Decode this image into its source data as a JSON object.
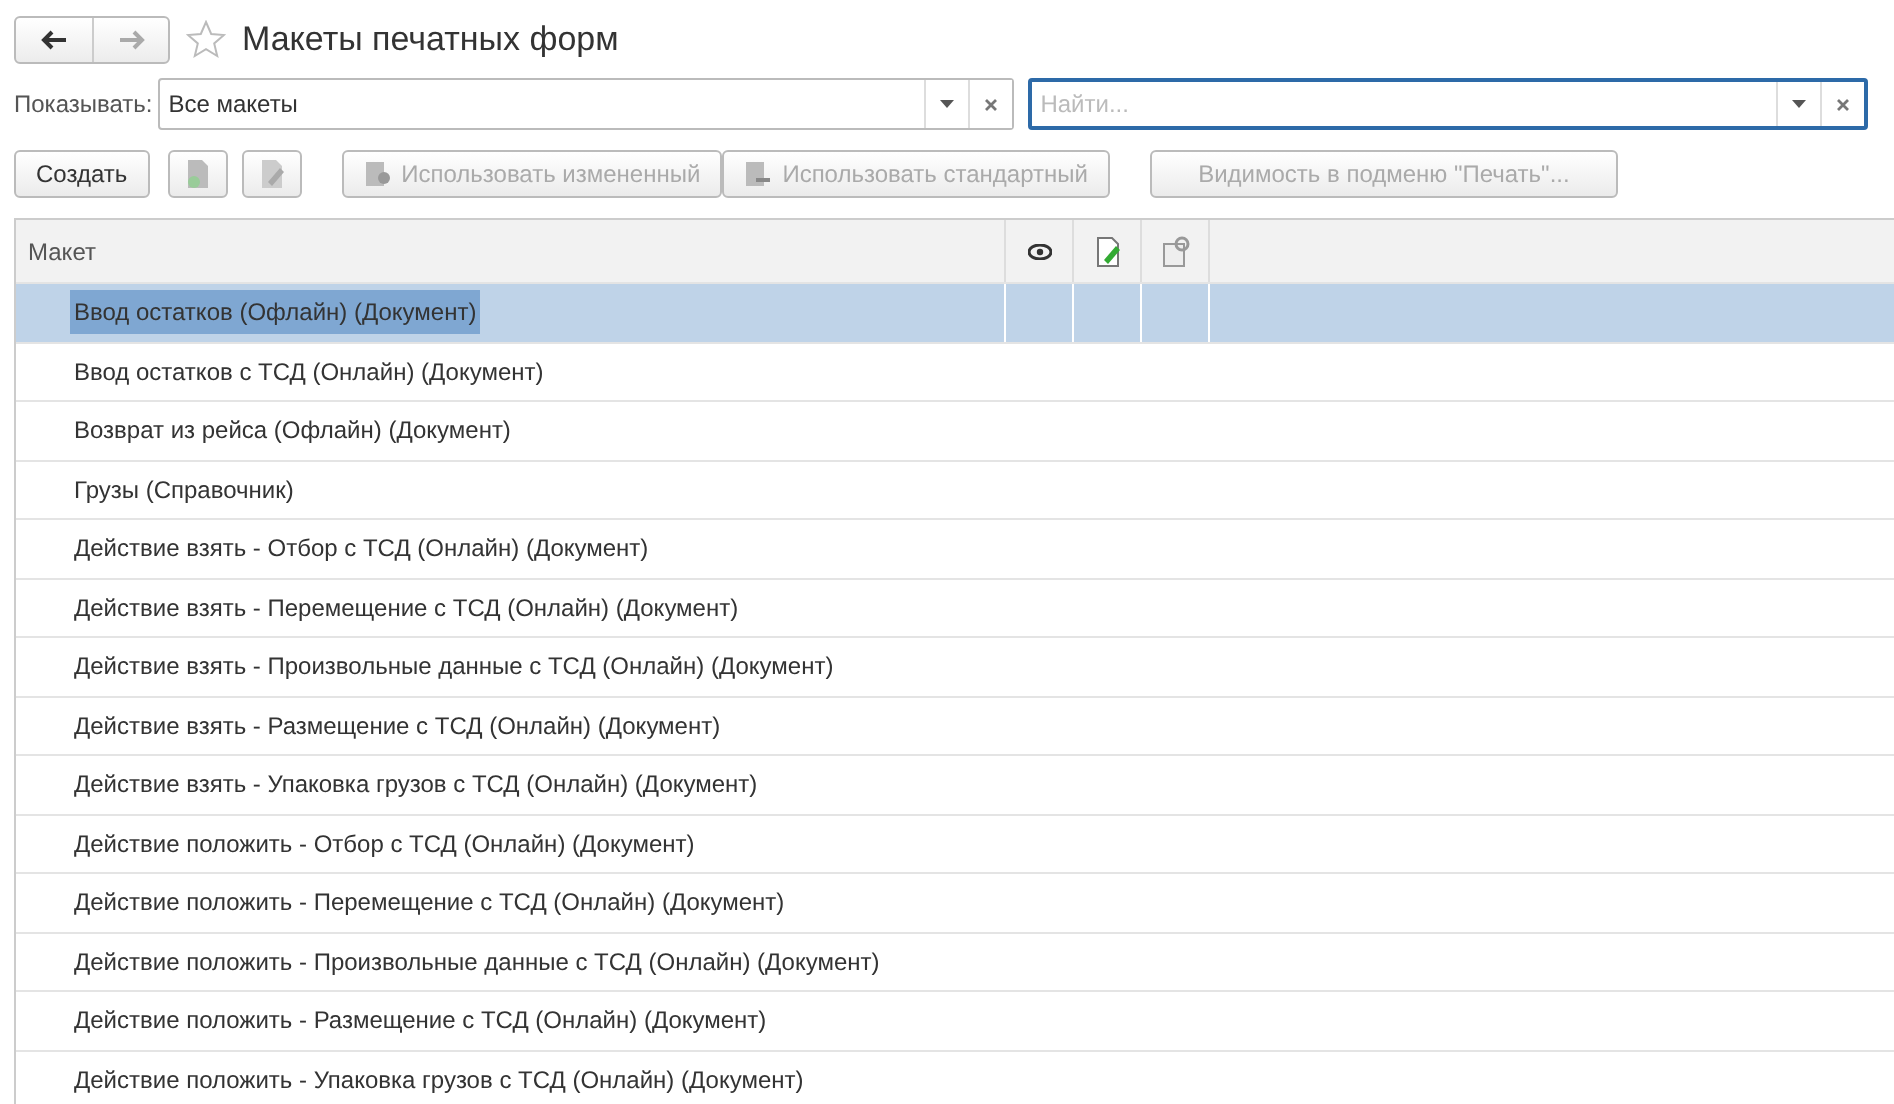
{
  "window": {
    "title": "Макеты печатных форм",
    "favorite": false
  },
  "filter": {
    "label": "Показывать:",
    "value": "Все макеты"
  },
  "search": {
    "placeholder": "Найти..."
  },
  "toolbar": {
    "create": "Создать",
    "use_changed": {
      "label": "Использовать измененный",
      "disabled": true
    },
    "use_standard": {
      "label": "Использовать стандартный",
      "disabled": true
    },
    "visibility": {
      "label": "Видимость в подменю \"Печать\"...",
      "disabled": true
    }
  },
  "table": {
    "columns": [
      "Макет"
    ],
    "rows": [
      {
        "name": "Ввод остатков (Офлайн) (Документ)",
        "selected": true
      },
      {
        "name": "Ввод остатков с ТСД (Онлайн) (Документ)",
        "selected": false
      },
      {
        "name": "Возврат из рейса (Офлайн) (Документ)",
        "selected": false
      },
      {
        "name": "Грузы (Справочник)",
        "selected": false
      },
      {
        "name": "Действие взять - Отбор с ТСД (Онлайн) (Документ)",
        "selected": false
      },
      {
        "name": "Действие взять - Перемещение с ТСД (Онлайн) (Документ)",
        "selected": false
      },
      {
        "name": "Действие взять - Произвольные данные с ТСД (Онлайн) (Документ)",
        "selected": false
      },
      {
        "name": "Действие взять - Размещение с ТСД (Онлайн) (Документ)",
        "selected": false
      },
      {
        "name": "Действие взять - Упаковка грузов с ТСД (Онлайн) (Документ)",
        "selected": false
      },
      {
        "name": "Действие положить - Отбор с ТСД (Онлайн) (Документ)",
        "selected": false
      },
      {
        "name": "Действие положить - Перемещение с ТСД (Онлайн) (Документ)",
        "selected": false
      },
      {
        "name": "Действие положить - Произвольные данные с ТСД (Онлайн) (Документ)",
        "selected": false
      },
      {
        "name": "Действие положить - Размещение с ТСД (Онлайн) (Документ)",
        "selected": false
      },
      {
        "name": "Действие положить - Упаковка грузов с ТСД (Онлайн) (Документ)",
        "selected": false
      }
    ]
  }
}
